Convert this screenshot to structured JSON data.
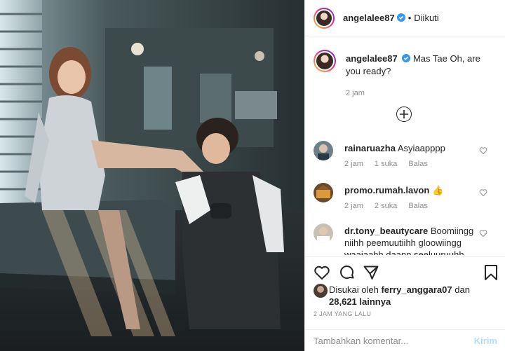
{
  "post": {
    "author": "angelalee87",
    "follow_status": "Diikuti",
    "separator": "•"
  },
  "caption": {
    "username": "angelalee87",
    "text": "Mas Tae Oh, are you ready?",
    "time": "2 jam"
  },
  "comments": [
    {
      "username": "rainaruazha",
      "text": "Asyiaapppp",
      "time": "2 jam",
      "likes": "1 suka",
      "reply": "Balas"
    },
    {
      "username": "promo.rumah.lavon",
      "text": "👍",
      "time": "2 jam",
      "likes": "2 suka",
      "reply": "Balas"
    },
    {
      "username": "dr.tony_beautycare",
      "text": "Boomiingg niihh peemuutiihh gloowiingg waajaahh daann seeluuruuhh"
    }
  ],
  "likes": {
    "prefix": "Disukai oleh",
    "user": "ferry_anggara07",
    "middle": "dan",
    "count": "28,621 lainnya"
  },
  "timestamp": "2 JAM YANG LALU",
  "composer": {
    "placeholder": "Tambahkan komentar...",
    "post_label": "Kirim"
  },
  "icons": {
    "heart": "heart-icon",
    "comment": "comment-icon",
    "share": "share-icon",
    "save": "bookmark-icon",
    "verified": "verified-icon",
    "add": "plus-circle-icon"
  },
  "colors": {
    "verified": "#3897f0",
    "post_button_disabled": "#b2dffc",
    "muted": "#8e8e8e"
  }
}
